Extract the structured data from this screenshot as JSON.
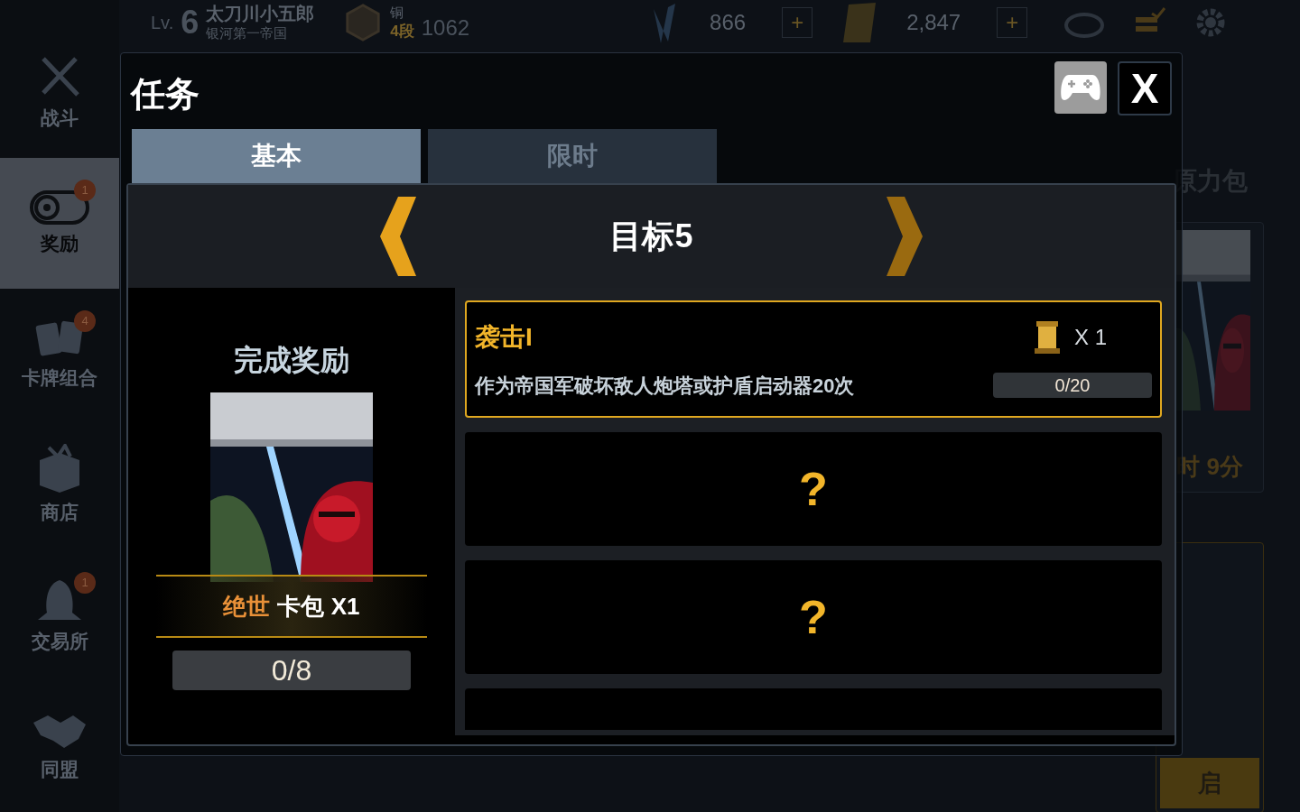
{
  "top_bar": {
    "level_label": "Lv.",
    "level": "6",
    "player_name": "太刀川小五郎",
    "faction": "银河第一帝国",
    "rank_tier": "铜",
    "rank_division": "4段",
    "rank_points": "1062",
    "crystals": "866",
    "credits": "2,847",
    "add_labels": [
      "+",
      "+"
    ]
  },
  "sidebar": {
    "items": [
      {
        "label": "战斗",
        "selected": false
      },
      {
        "label": "奖励",
        "selected": true,
        "badge": "1"
      },
      {
        "label": "卡牌组合",
        "selected": false,
        "badge": "4"
      },
      {
        "label": "商店",
        "selected": false
      },
      {
        "label": "交易所",
        "selected": false,
        "badge": "1"
      },
      {
        "label": "同盟",
        "selected": false
      }
    ]
  },
  "background_panel": {
    "title": "原力包",
    "timer": "时 9分",
    "button": "启"
  },
  "modal": {
    "title": "任务",
    "close_label": "X",
    "tabs": [
      {
        "label": "基本",
        "selected": true
      },
      {
        "label": "限时",
        "selected": false
      }
    ],
    "goal": {
      "title": "目标5"
    },
    "reward": {
      "heading": "完成奖励",
      "rarity": "绝世",
      "label": "卡包 X1",
      "progress": "0/8",
      "level": 0
    },
    "tasks": [
      {
        "kind": "task",
        "title": "袭击I",
        "description": "作为帝国军破坏敌人炮塔或护盾启动器20次",
        "reward_count": "X 1",
        "progress": "0/20",
        "level": 0
      },
      {
        "kind": "locked",
        "mark": "?"
      },
      {
        "kind": "locked",
        "mark": "?"
      },
      {
        "kind": "partial"
      }
    ]
  }
}
